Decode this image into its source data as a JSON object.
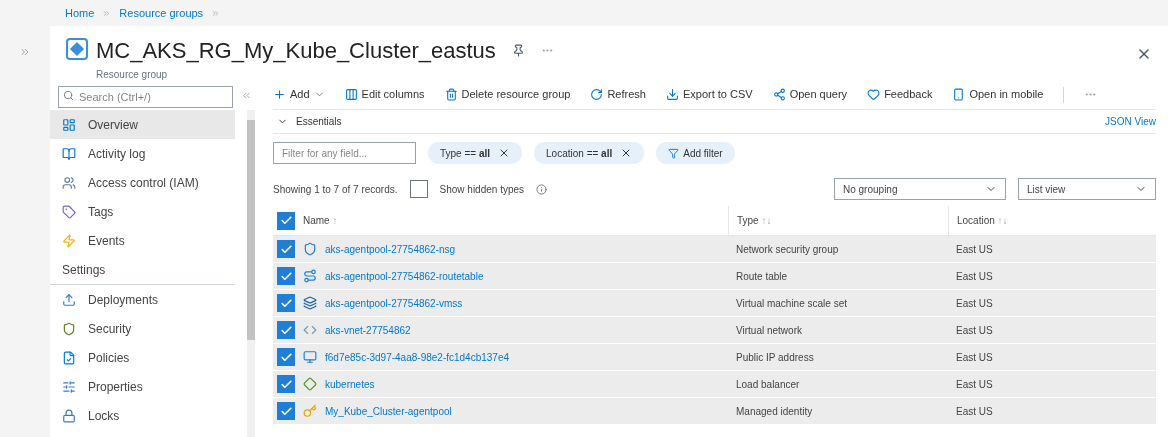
{
  "breadcrumb": [
    "Home",
    "Resource groups"
  ],
  "header": {
    "title": "MC_AKS_RG_My_Kube_Cluster_eastus",
    "subtitle": "Resource group"
  },
  "sidebar": {
    "search": {
      "placeholder": "Search (Ctrl+/)"
    },
    "items": [
      {
        "label": "Overview",
        "kind": "overview",
        "selected": true
      },
      {
        "label": "Activity log",
        "kind": "log",
        "selected": false
      },
      {
        "label": "Access control (IAM)",
        "kind": "iam",
        "selected": false
      },
      {
        "label": "Tags",
        "kind": "tag",
        "selected": false
      },
      {
        "label": "Events",
        "kind": "bolt",
        "selected": false
      }
    ],
    "section": "Settings",
    "settings_items": [
      {
        "label": "Deployments",
        "kind": "upload",
        "selected": false
      },
      {
        "label": "Security",
        "kind": "shield",
        "selected": false
      },
      {
        "label": "Policies",
        "kind": "policy",
        "selected": false
      },
      {
        "label": "Properties",
        "kind": "props",
        "selected": false
      },
      {
        "label": "Locks",
        "kind": "lock",
        "selected": false
      }
    ]
  },
  "toolbar": [
    {
      "label": "Add",
      "kind": "add"
    },
    {
      "label": "Edit columns",
      "kind": "columns"
    },
    {
      "label": "Delete resource group",
      "kind": "delete"
    },
    {
      "label": "Refresh",
      "kind": "refresh"
    },
    {
      "label": "Export to CSV",
      "kind": "export"
    },
    {
      "label": "Open query",
      "kind": "query"
    },
    {
      "label": "Feedback",
      "kind": "heart"
    },
    {
      "label": "Open in mobile",
      "kind": "mobile"
    }
  ],
  "essentials": {
    "label": "Essentials",
    "link": "JSON View",
    "expanded": false
  },
  "filters": {
    "placeholder": "Filter for any field...",
    "pills": [
      {
        "label": "Type == ",
        "value": "all"
      },
      {
        "label": "Location == ",
        "value": "all"
      }
    ],
    "add": "Add filter"
  },
  "records": "Showing 1 to 7 of 7 records.",
  "show_hidden": {
    "label": "Show hidden types",
    "checked": false
  },
  "grouping": "No grouping",
  "view": "List view",
  "table": {
    "all_checked": true,
    "columns": [
      {
        "label": "Name",
        "sort": "↑"
      },
      {
        "label": "Type",
        "sort": "↑↓"
      },
      {
        "label": "Location",
        "sort": "↑↓"
      }
    ],
    "rows": [
      {
        "name": "aks-agentpool-27754862-nsg",
        "kind": "nsg",
        "type": "Network security group",
        "location": "East US",
        "checked": true
      },
      {
        "name": "aks-agentpool-27754862-routetable",
        "kind": "route",
        "type": "Route table",
        "location": "East US",
        "checked": true
      },
      {
        "name": "aks-agentpool-27754862-vmss",
        "kind": "vmss",
        "type": "Virtual machine scale set",
        "location": "East US",
        "checked": true
      },
      {
        "name": "aks-vnet-27754862",
        "kind": "vnet",
        "type": "Virtual network",
        "location": "East US",
        "checked": true
      },
      {
        "name": "f6d7e85c-3d97-4aa8-98e2-fc1d4cb137e4",
        "kind": "ip",
        "type": "Public IP address",
        "location": "East US",
        "checked": true
      },
      {
        "name": "kubernetes",
        "kind": "lb",
        "type": "Load balancer",
        "location": "East US",
        "checked": true
      },
      {
        "name": "My_Kube_Cluster-agentpool",
        "kind": "identity",
        "type": "Managed identity",
        "location": "East US",
        "checked": true
      }
    ]
  }
}
